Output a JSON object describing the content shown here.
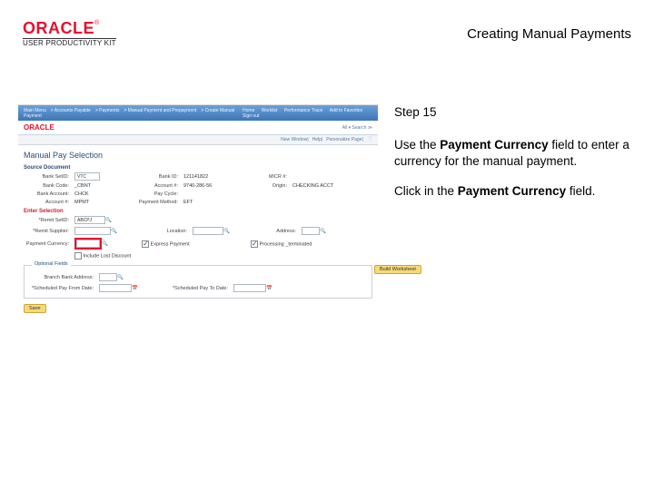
{
  "header": {
    "brand": "ORACLE",
    "trademark": "®",
    "product": "USER PRODUCTIVITY KIT",
    "doc_title": "Creating Manual Payments"
  },
  "instructions": {
    "step": "Step 15",
    "p1_a": "Use the ",
    "p1_b": "Payment Currency",
    "p1_c": " field to enter a currency for the manual payment.",
    "p2_a": "Click in the ",
    "p2_b": "Payment Currency",
    "p2_c": " field."
  },
  "shot": {
    "topbar_left": [
      "Main Menu",
      "Accounts Payable",
      "Payments",
      "Manual Payment and Prepayment",
      "Create Manual Payment"
    ],
    "topbar_right": [
      "Home",
      "Worklist",
      "Performance Trace",
      "Add to Favorites",
      "Sign out"
    ],
    "sub_logo": "ORACLE",
    "sub_right": "All ▾  Search  ≫",
    "underbar": [
      "New Window",
      "Help",
      "Personalize Page",
      "📄"
    ],
    "page_title": "Manual Pay Selection",
    "sections": {
      "source": "Source Document",
      "enter": "Enter Selection",
      "optional": "Optional Fields"
    },
    "fields": {
      "bank_setid_l": "Bank SetID:",
      "bank_setid_v": "VTC",
      "bank_id_l": "Bank ID:",
      "bank_id_v": "121141822",
      "mcr_l": "MICR #:",
      "bank_code_l": "Bank Code:",
      "bank_code_v": "_CBNT",
      "account_num_l": "Account #:",
      "account_num_v": "9740-286-56",
      "origin_l": "Origin:",
      "origin_v": "CHECKING ACCT",
      "bank_account_l": "Bank Account:",
      "bank_account_v": "CHCK",
      "pay_cycle_l": "Pay Cycle:",
      "account_desc_l": "Account #:",
      "account_desc_v": "MPMT",
      "pay_method_l": "Payment Method:",
      "pay_method_v": "EFT",
      "remit_setid_l": "*Remit SetID:",
      "remit_setid_v": "ABCPJ",
      "remit_supplier_l": "*Remit Supplier:",
      "location_l": "Location:",
      "address_l": "Address:",
      "payment_currency_l": "Payment Currency:",
      "express_l": "Express Payment",
      "include_lost_l": "Include Lost Discount",
      "processing_l": "Processing _terminated",
      "branch_l": "Branch Bank Address:",
      "sched_l": "*Scheduled Pay From Date:",
      "sched_to_l": "*Scheduled Pay To Date:"
    },
    "buttons": {
      "build": "Build Worksheet",
      "save": "Save"
    }
  }
}
